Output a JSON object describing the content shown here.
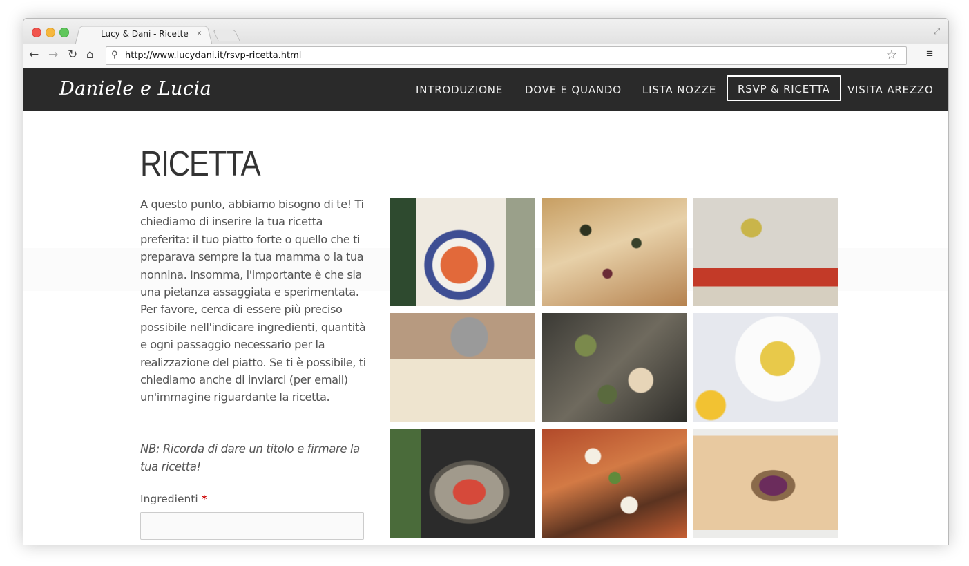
{
  "browser": {
    "tab_title": "Lucy & Dani - Ricette",
    "tab_close": "×",
    "url": "http://www.lucydani.it/rsvp-ricetta.html",
    "icons": {
      "back": "←",
      "forward": "→",
      "reload": "↻",
      "home": "⌂",
      "search": "⚲",
      "star": "☆",
      "menu": "≡",
      "expand": "⤢"
    }
  },
  "site": {
    "logo": "Daniele e Lucia",
    "nav": [
      {
        "label": "INTRODUZIONE",
        "active": false
      },
      {
        "label": "DOVE E QUANDO",
        "active": false
      },
      {
        "label": "LISTA NOZZE",
        "active": false
      },
      {
        "label": "RSVP & RICETTA",
        "active": true
      },
      {
        "label": "VISITA AREZZO",
        "active": false
      }
    ],
    "colors": {
      "nav_bg": "#2a2a2a",
      "text": "#555555",
      "required": "#cc0000"
    }
  },
  "main": {
    "title": "RICETTA",
    "intro": "A questo punto, abbiamo bisogno di te! Ti chiediamo di inserire la tua ricetta preferita: il tuo piatto forte o quello che ti preparava sempre la tua mamma o la tua nonnina. Insomma, l'importante è che sia una pietanza assaggiata e sperimentata. Per favore, cerca di essere più preciso possibile nell'indicare ingredienti, quantità e ogni passaggio necessario per la realizzazione del piatto. Se ti è possibile, ti chiediamo anche di inviarci (per email) un'immagine riguardante la ricetta.",
    "note": "NB: Ricorda di dare un titolo e firmare la tua ricetta!",
    "form": {
      "ingredients_label": "Ingredienti",
      "required_mark": "*",
      "ingredients_value": ""
    }
  },
  "gallery": [
    "pasta-bowl-photo",
    "focaccia-photo",
    "olive-oil-pizza-photo",
    "pasta-machine-photo",
    "shared-table-photo",
    "ravioli-lemon-photo",
    "fish-pan-photo",
    "pizza-arugula-photo",
    "salad-bowl-photo"
  ]
}
